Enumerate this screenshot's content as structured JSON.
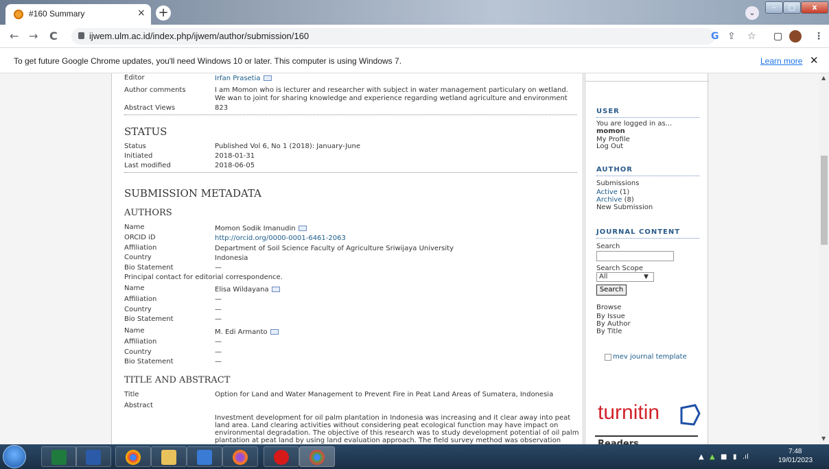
{
  "browser": {
    "tab_title": "#160 Summary",
    "tab_close": "×",
    "new_tab": "+",
    "tab_search": "⌄",
    "url": "ijwem.ulm.ac.id/index.php/ijwem/author/submission/160",
    "back": "←",
    "forward": "→",
    "reload": "C",
    "google_icon": "G",
    "share_icon": "⇪",
    "bookmark_icon": "☆",
    "window_icon": "▢",
    "menu_icon": "⋮"
  },
  "infobar": {
    "text": "To get future Google Chrome updates, you'll need Windows 10 or later. This computer is using Windows 7.",
    "learn_more": "Learn more",
    "close": "✕"
  },
  "content": {
    "editor_label": "Editor",
    "editor_value": "Irfan Prasetia",
    "author_comments_label": "Author comments",
    "author_comments_line1": "I am Momon who is lecturer and researcher with subject in water management particulary on wetland.",
    "author_comments_line2": "We wan to joint for sharing knowledge and experience regarding wetland agriculture and environment",
    "abstract_views_label": "Abstract Views",
    "abstract_views_value": "823",
    "status_heading": "STATUS",
    "status_label": "Status",
    "status_value": "Published   Vol 6, No 1 (2018): January-June",
    "initiated_label": "Initiated",
    "initiated_value": "2018-01-31",
    "last_modified_label": "Last modified",
    "last_modified_value": "2018-06-05",
    "metadata_heading": "SUBMISSION METADATA",
    "authors_heading": "AUTHORS",
    "name_label": "Name",
    "orcid_label": "ORCID iD",
    "affiliation_label": "Affiliation",
    "country_label": "Country",
    "bio_label": "Bio Statement",
    "dash": "—",
    "author1_name": "Momon Sodik Imanudin",
    "author1_orcid": "http://orcid.org/0000-0001-6461-2063",
    "author1_affiliation": "Department of Soil Science Faculty of Agriculture Sriwijaya University",
    "author1_country": "Indonesia",
    "principal_contact": "Principal contact for editorial correspondence.",
    "author2_name": "Elisa Wildayana",
    "author3_name": "M. Edi Armanto",
    "title_abstract_heading": "TITLE AND ABSTRACT",
    "title_label": "Title",
    "title_value": "Option for Land and Water Management to Prevent Fire in Peat Land Areas of Sumatera, Indonesia",
    "abstract_label": "Abstract",
    "abstract_line1": "Investment development for oil palm plantation in Indonesia was increasing and it clear away into peat",
    "abstract_line2": "land area. Land clearing activities without considering peat ecological function may have impact on",
    "abstract_line3": "environmental degradation. The objective of this research was to study development potential of oil palm",
    "abstract_line4": "plantation at peat land by using land evaluation approach. The field survey method was observation"
  },
  "sidebar": {
    "user_heading": "USER",
    "logged_in_as": "You are logged in as...",
    "username": "momon",
    "my_profile": "My Profile",
    "log_out": "Log Out",
    "author_heading": "AUTHOR",
    "submissions": "Submissions",
    "active": "Active",
    "active_count": "(1)",
    "archive": "Archive",
    "archive_count": "(8)",
    "new_submission": "New Submission",
    "journal_content_heading": "JOURNAL CONTENT",
    "search_label": "Search",
    "search_scope_label": "Search Scope",
    "scope_selected": "All",
    "search_button": "Search",
    "browse": "Browse",
    "by_issue": "By Issue",
    "by_author": "By Author",
    "by_title": "By Title",
    "template_alt": "mev journal template",
    "turnitin": "turnitin",
    "readers_partial": "Readers"
  },
  "taskbar": {
    "time": "7:48",
    "date": "19/01/2023"
  }
}
